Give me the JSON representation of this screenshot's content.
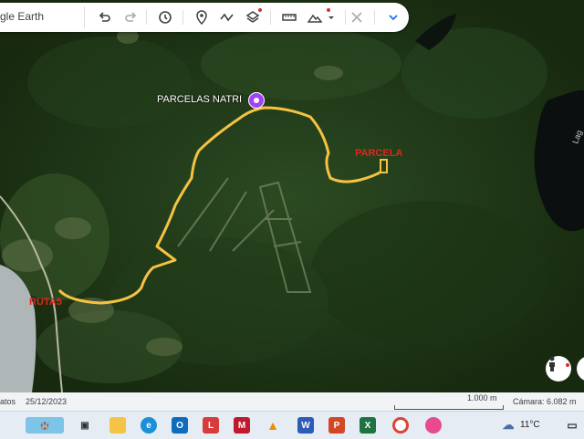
{
  "app": {
    "search_text": "gle Earth"
  },
  "toolbar_icons": [
    "undo-icon",
    "redo-icon",
    "history-icon",
    "placemark-icon",
    "path-icon",
    "layers-icon",
    "ruler-icon",
    "terrain-icon",
    "collapse-icon",
    "chevron-down-icon"
  ],
  "map": {
    "placemark_label": "PARCELAS NATRI",
    "parcel_label": "PARCELA",
    "route_label": "RUTA5",
    "lake_label": "Lag",
    "colors": {
      "route": "#f5c242",
      "red_label": "#e0261b",
      "forest": "#1f3a18"
    }
  },
  "status_bar": {
    "left_text": "atos",
    "date": "25/12/2023",
    "scale": "1.000 m",
    "camera": "Cámara: 6.082 m"
  },
  "taskbar": {
    "weather": "11°C",
    "apps": [
      "file-explorer",
      "edge",
      "outlook",
      "l-app",
      "mcafee",
      "vlc",
      "word",
      "powerpoint",
      "excel",
      "chrome",
      "photos"
    ]
  }
}
